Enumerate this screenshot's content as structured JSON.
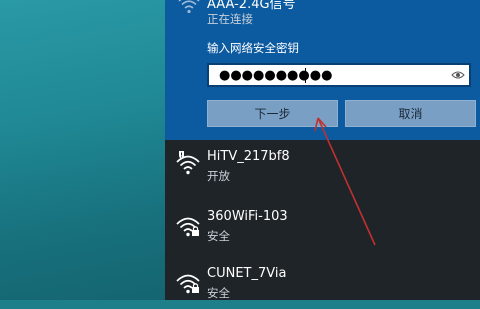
{
  "selected_network": {
    "name": "AAA-2.4G信号",
    "status": "正在连接",
    "password_label": "输入网络安全密钥",
    "password_value": "●●●●●●●●●●",
    "next_button": "下一步",
    "cancel_button": "取消"
  },
  "networks": [
    {
      "name": "HiTV_217bf8",
      "status": "开放",
      "icon": "wifi-warning-icon"
    },
    {
      "name": "360WiFi-103",
      "status": "安全",
      "icon": "wifi-icon"
    },
    {
      "name": "CUNET_7Via",
      "status": "安全",
      "icon": "wifi-icon"
    }
  ],
  "colors": {
    "selected_bg": "#0c5aa0",
    "flyout_bg": "#1f2429",
    "annotation_arrow": "#c0302f"
  }
}
